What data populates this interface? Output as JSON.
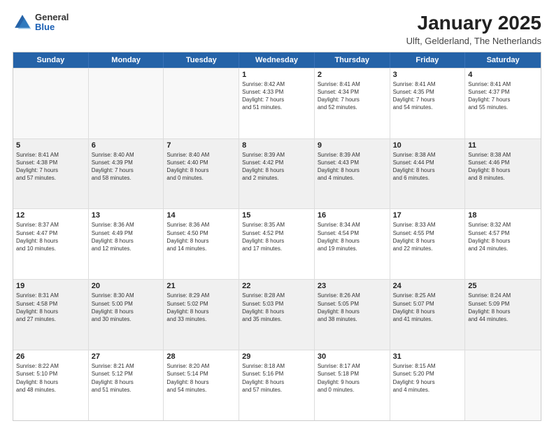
{
  "logo": {
    "general": "General",
    "blue": "Blue"
  },
  "title": "January 2025",
  "subtitle": "Ulft, Gelderland, The Netherlands",
  "days": [
    "Sunday",
    "Monday",
    "Tuesday",
    "Wednesday",
    "Thursday",
    "Friday",
    "Saturday"
  ],
  "weeks": [
    [
      {
        "day": "",
        "info": ""
      },
      {
        "day": "",
        "info": ""
      },
      {
        "day": "",
        "info": ""
      },
      {
        "day": "1",
        "info": "Sunrise: 8:42 AM\nSunset: 4:33 PM\nDaylight: 7 hours\nand 51 minutes."
      },
      {
        "day": "2",
        "info": "Sunrise: 8:41 AM\nSunset: 4:34 PM\nDaylight: 7 hours\nand 52 minutes."
      },
      {
        "day": "3",
        "info": "Sunrise: 8:41 AM\nSunset: 4:35 PM\nDaylight: 7 hours\nand 54 minutes."
      },
      {
        "day": "4",
        "info": "Sunrise: 8:41 AM\nSunset: 4:37 PM\nDaylight: 7 hours\nand 55 minutes."
      }
    ],
    [
      {
        "day": "5",
        "info": "Sunrise: 8:41 AM\nSunset: 4:38 PM\nDaylight: 7 hours\nand 57 minutes."
      },
      {
        "day": "6",
        "info": "Sunrise: 8:40 AM\nSunset: 4:39 PM\nDaylight: 7 hours\nand 58 minutes."
      },
      {
        "day": "7",
        "info": "Sunrise: 8:40 AM\nSunset: 4:40 PM\nDaylight: 8 hours\nand 0 minutes."
      },
      {
        "day": "8",
        "info": "Sunrise: 8:39 AM\nSunset: 4:42 PM\nDaylight: 8 hours\nand 2 minutes."
      },
      {
        "day": "9",
        "info": "Sunrise: 8:39 AM\nSunset: 4:43 PM\nDaylight: 8 hours\nand 4 minutes."
      },
      {
        "day": "10",
        "info": "Sunrise: 8:38 AM\nSunset: 4:44 PM\nDaylight: 8 hours\nand 6 minutes."
      },
      {
        "day": "11",
        "info": "Sunrise: 8:38 AM\nSunset: 4:46 PM\nDaylight: 8 hours\nand 8 minutes."
      }
    ],
    [
      {
        "day": "12",
        "info": "Sunrise: 8:37 AM\nSunset: 4:47 PM\nDaylight: 8 hours\nand 10 minutes."
      },
      {
        "day": "13",
        "info": "Sunrise: 8:36 AM\nSunset: 4:49 PM\nDaylight: 8 hours\nand 12 minutes."
      },
      {
        "day": "14",
        "info": "Sunrise: 8:36 AM\nSunset: 4:50 PM\nDaylight: 8 hours\nand 14 minutes."
      },
      {
        "day": "15",
        "info": "Sunrise: 8:35 AM\nSunset: 4:52 PM\nDaylight: 8 hours\nand 17 minutes."
      },
      {
        "day": "16",
        "info": "Sunrise: 8:34 AM\nSunset: 4:54 PM\nDaylight: 8 hours\nand 19 minutes."
      },
      {
        "day": "17",
        "info": "Sunrise: 8:33 AM\nSunset: 4:55 PM\nDaylight: 8 hours\nand 22 minutes."
      },
      {
        "day": "18",
        "info": "Sunrise: 8:32 AM\nSunset: 4:57 PM\nDaylight: 8 hours\nand 24 minutes."
      }
    ],
    [
      {
        "day": "19",
        "info": "Sunrise: 8:31 AM\nSunset: 4:58 PM\nDaylight: 8 hours\nand 27 minutes."
      },
      {
        "day": "20",
        "info": "Sunrise: 8:30 AM\nSunset: 5:00 PM\nDaylight: 8 hours\nand 30 minutes."
      },
      {
        "day": "21",
        "info": "Sunrise: 8:29 AM\nSunset: 5:02 PM\nDaylight: 8 hours\nand 33 minutes."
      },
      {
        "day": "22",
        "info": "Sunrise: 8:28 AM\nSunset: 5:03 PM\nDaylight: 8 hours\nand 35 minutes."
      },
      {
        "day": "23",
        "info": "Sunrise: 8:26 AM\nSunset: 5:05 PM\nDaylight: 8 hours\nand 38 minutes."
      },
      {
        "day": "24",
        "info": "Sunrise: 8:25 AM\nSunset: 5:07 PM\nDaylight: 8 hours\nand 41 minutes."
      },
      {
        "day": "25",
        "info": "Sunrise: 8:24 AM\nSunset: 5:09 PM\nDaylight: 8 hours\nand 44 minutes."
      }
    ],
    [
      {
        "day": "26",
        "info": "Sunrise: 8:22 AM\nSunset: 5:10 PM\nDaylight: 8 hours\nand 48 minutes."
      },
      {
        "day": "27",
        "info": "Sunrise: 8:21 AM\nSunset: 5:12 PM\nDaylight: 8 hours\nand 51 minutes."
      },
      {
        "day": "28",
        "info": "Sunrise: 8:20 AM\nSunset: 5:14 PM\nDaylight: 8 hours\nand 54 minutes."
      },
      {
        "day": "29",
        "info": "Sunrise: 8:18 AM\nSunset: 5:16 PM\nDaylight: 8 hours\nand 57 minutes."
      },
      {
        "day": "30",
        "info": "Sunrise: 8:17 AM\nSunset: 5:18 PM\nDaylight: 9 hours\nand 0 minutes."
      },
      {
        "day": "31",
        "info": "Sunrise: 8:15 AM\nSunset: 5:20 PM\nDaylight: 9 hours\nand 4 minutes."
      },
      {
        "day": "",
        "info": ""
      }
    ]
  ]
}
